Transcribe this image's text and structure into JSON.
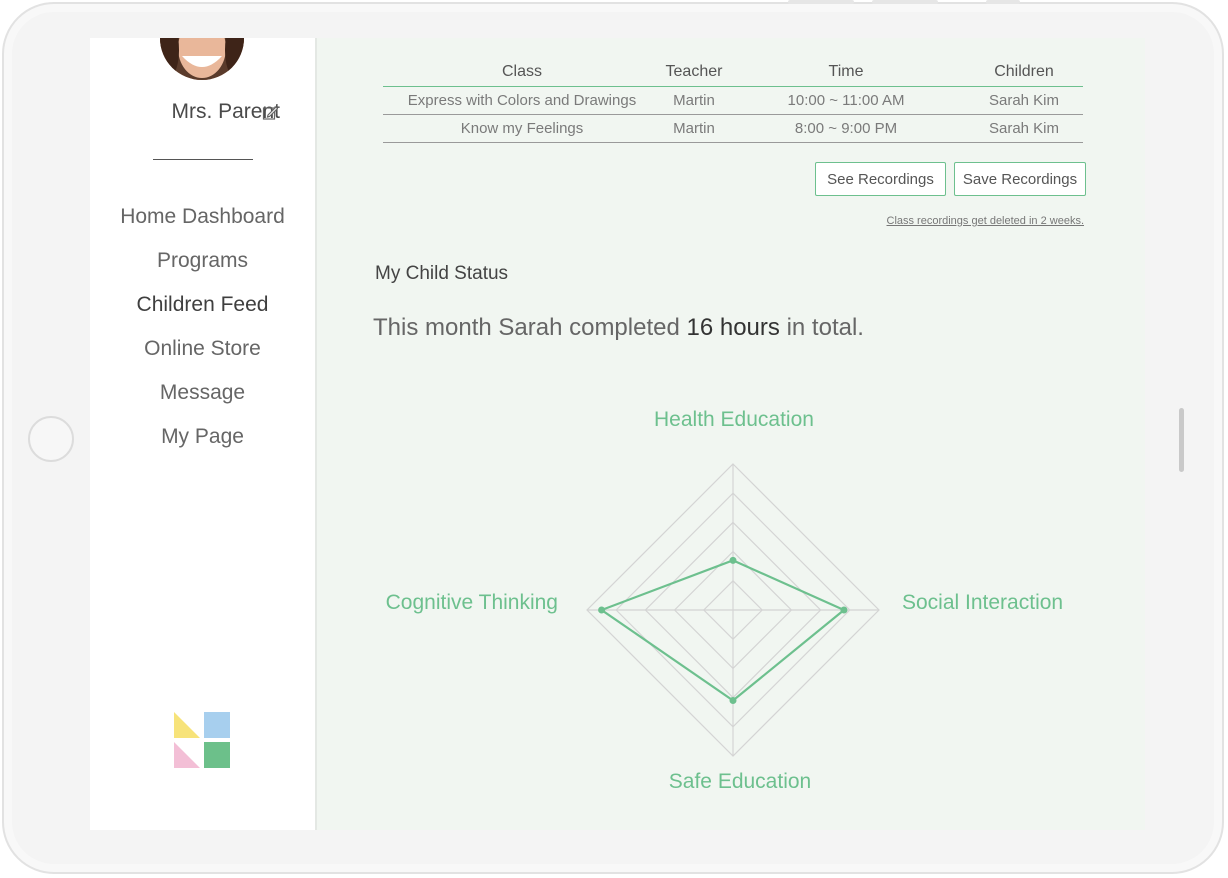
{
  "profile": {
    "name": "Mrs. Parent"
  },
  "nav": {
    "items": [
      {
        "label": "Home Dashboard"
      },
      {
        "label": "Programs"
      },
      {
        "label": "Children Feed"
      },
      {
        "label": "Online Store"
      },
      {
        "label": "Message"
      },
      {
        "label": "My Page"
      }
    ],
    "active": "Children Feed"
  },
  "classes_table": {
    "headers": {
      "class": "Class",
      "teacher": "Teacher",
      "time": "Time",
      "children": "Children"
    },
    "rows": [
      {
        "class": "Express with Colors and Drawings",
        "teacher": "Martin",
        "time": "10:00 ~ 11:00 AM",
        "children": "Sarah Kim"
      },
      {
        "class": "Know my Feelings",
        "teacher": "Martin",
        "time": "8:00 ~ 9:00 PM",
        "children": "Sarah Kim"
      }
    ]
  },
  "buttons": {
    "see_recordings": "See Recordings",
    "save_recordings": "Save Recordings"
  },
  "note": "Class recordings get deleted in 2 weeks.",
  "status": {
    "title": "My Child Status",
    "summary_prefix": "This month Sarah completed ",
    "summary_bold": "16 hours",
    "summary_suffix": " in total."
  },
  "chart_data": {
    "type": "radar",
    "axes": [
      "Health Education",
      "Social Interaction",
      "Safe Education",
      "Cognitive Thinking"
    ],
    "levels": 5,
    "max": 5,
    "values": [
      1.7,
      3.8,
      3.1,
      4.5
    ]
  },
  "colors": {
    "accent": "#6dc08e",
    "logo": [
      "#f7e37a",
      "#a7cfee",
      "#f3bfd6",
      "#6cc08a"
    ]
  }
}
